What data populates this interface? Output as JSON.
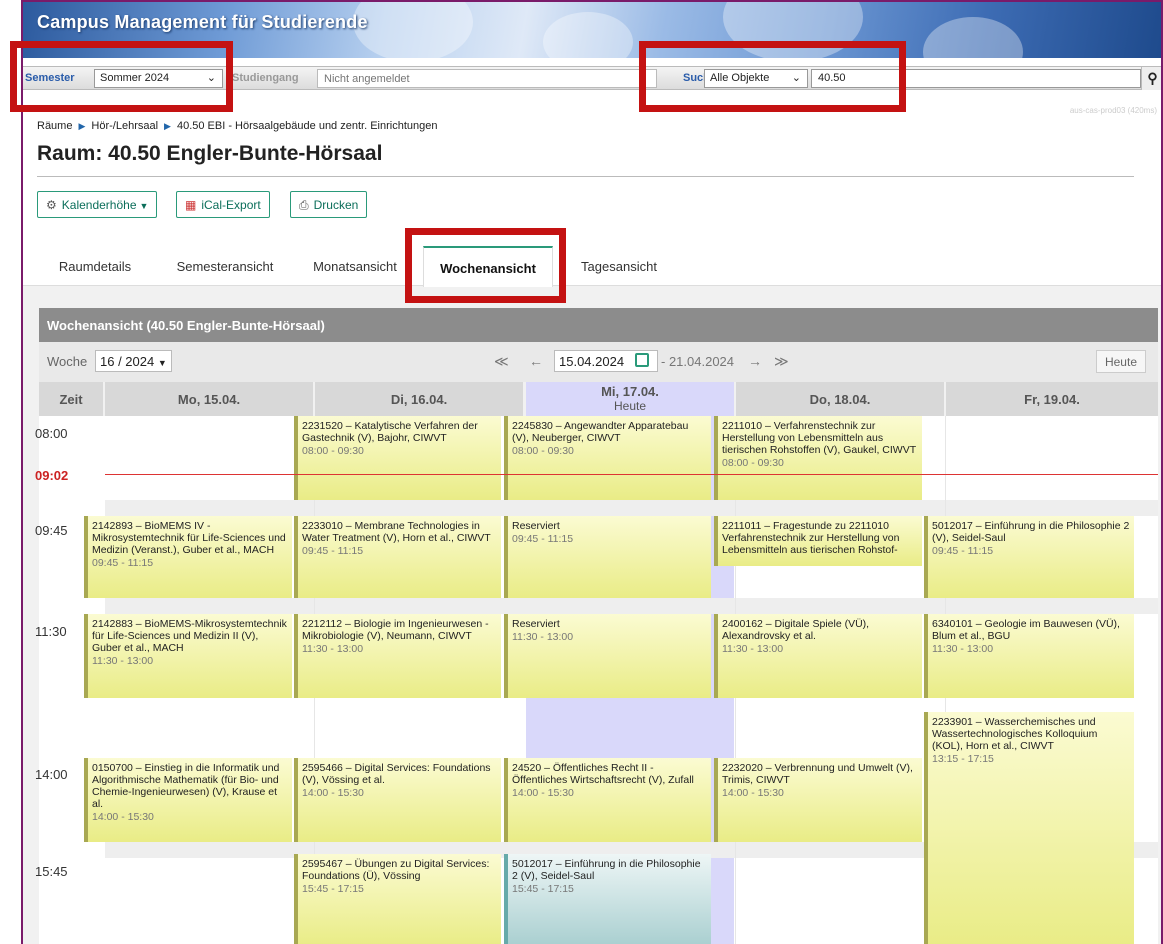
{
  "app": {
    "title": "Campus Management für Studierende",
    "server_info": "aus-cas-prod03 (420ms)"
  },
  "filter": {
    "semester_label": "Semester",
    "semester_value": "Sommer 2024",
    "studiengang_label": "Studiengang",
    "studiengang_placeholder": "Nicht angemeldet",
    "suche_label": "Suche",
    "suche_scope": "Alle Objekte",
    "suche_value": "40.50"
  },
  "breadcrumb": [
    "Räume",
    "Hör-/Lehrsaal",
    "40.50 EBI - Hörsaalgebäude und zentr. Einrichtungen"
  ],
  "page_title": "Raum: 40.50 Engler-Bunte-Hörsaal",
  "toolbar": {
    "kalender": "Kalenderhöhe",
    "ical": "iCal-Export",
    "print": "Drucken"
  },
  "tabs": [
    "Raumdetails",
    "Semesteransicht",
    "Monatsansicht",
    "Wochenansicht",
    "Tagesansicht"
  ],
  "active_tab": "Wochenansicht",
  "weekview": {
    "title": "Wochenansicht (40.50 Engler-Bunte-Hörsaal)",
    "week_label": "Woche",
    "week_value": "16 / 2024",
    "date_start": "15.04.2024",
    "date_end": "- 21.04.2024",
    "today_btn": "Heute",
    "zeit": "Zeit",
    "days": [
      "Mo, 15.04.",
      "Di, 16.04.",
      "Mi, 17.04.",
      "Do, 18.04.",
      "Fr, 19.04."
    ],
    "today_sub": "Heute",
    "times": [
      "08:00",
      "09:45",
      "11:30",
      "14:00",
      "15:45"
    ],
    "now": "09:02"
  },
  "events": {
    "di_0800": {
      "title": "2231520 – Katalytische Verfahren der Gastechnik (V), Bajohr, CIWVT",
      "time": "08:00 - 09:30"
    },
    "mi_0800": {
      "title": "2245830 – Angewandter Apparatebau (V), Neuberger, CIWVT",
      "time": "08:00 - 09:30"
    },
    "do_0800": {
      "title": "2211010 – Verfahrenstechnik zur Herstellung von Lebensmitteln aus tierischen Rohstoffen (V), Gaukel, CIWVT",
      "time": "08:00 - 09:30"
    },
    "mo_0945": {
      "title": "2142893 – BioMEMS IV - Mikrosystemtechnik für Life-Sciences und Medizin (Veranst.), Guber et al., MACH",
      "time": "09:45 - 11:15"
    },
    "di_0945": {
      "title": "2233010 – Membrane Technologies in Water Treatment (V), Horn et al., CIWVT",
      "time": "09:45 - 11:15"
    },
    "mi_0945": {
      "title": "Reserviert",
      "time": "09:45 - 11:15"
    },
    "do_0945": {
      "title": "2211011 – Fragestunde zu 2211010 Verfahrenstechnik zur Herstellung von Lebensmitteln aus tierischen Rohstof-"
    },
    "fr_0945": {
      "title": "5012017 – Einführung in die Philosophie 2 (V), Seidel-Saul",
      "time": "09:45 - 11:15"
    },
    "mo_1130": {
      "title": "2142883 – BioMEMS-Mikrosystemtechnik für Life-Sciences und Medizin II (V), Guber et al., MACH",
      "time": "11:30 - 13:00"
    },
    "di_1130": {
      "title": "2212112 – Biologie im Ingenieurwesen - Mikrobiologie (V), Neumann, CIWVT",
      "time": "11:30 - 13:00"
    },
    "mi_1130": {
      "title": "Reserviert",
      "time": "11:30 - 13:00"
    },
    "do_1130": {
      "title": "2400162 – Digitale Spiele (VÜ), Alexandrovsky et al.",
      "time": "11:30 - 13:00"
    },
    "fr_1130": {
      "title": "6340101 – Geologie im Bauwesen (VÜ), Blum et al., BGU",
      "time": "11:30 - 13:00"
    },
    "fr_1315": {
      "title": "2233901 – Wasserchemisches und Wassertechnologisches Kolloquium (KOL), Horn et al., CIWVT",
      "time": "13:15 - 17:15"
    },
    "mo_1400": {
      "title": "0150700 – Einstieg in die Informatik und Algorithmische Mathematik (für Bio- und Chemie-Ingenieurwesen) (V), Krause et al.",
      "time": "14:00 - 15:30"
    },
    "di_1400": {
      "title": "2595466 – Digital Services: Foundations (V), Vössing et al.",
      "time": "14:00 - 15:30"
    },
    "mi_1400": {
      "title": "24520 – Öffentliches Recht II - Öffentliches Wirtschaftsrecht (V), Zufall",
      "time": "14:00 - 15:30"
    },
    "do_1400": {
      "title": "2232020 – Verbrennung und Umwelt (V), Trimis, CIWVT",
      "time": "14:00 - 15:30"
    },
    "di_1545": {
      "title": "2595467 – Übungen zu Digital Services: Foundations (Ü), Vössing",
      "time": "15:45 - 17:15"
    },
    "mi_1545": {
      "title": "5012017 – Einführung in die Philosophie 2 (V), Seidel-Saul",
      "time": "15:45 - 17:15"
    }
  },
  "colors": {
    "accent": "#2a9a7a",
    "annotation": "#c41212",
    "today": "#d9d8fa",
    "frame": "#7a1b6a"
  }
}
